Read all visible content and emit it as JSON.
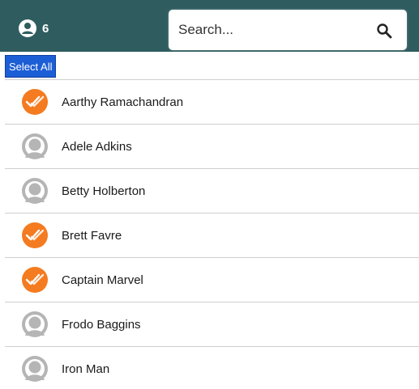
{
  "header": {
    "user_count": "6",
    "background_color": "#2f5d5f",
    "count_icon": "user-circle-icon"
  },
  "search": {
    "placeholder": "Search...",
    "value": "",
    "icon": "search-icon"
  },
  "select_all": {
    "label": "Select All",
    "color": "#1c5ed6"
  },
  "users": [
    {
      "name": "Aarthy Ramachandran",
      "selected": true
    },
    {
      "name": "Adele Adkins",
      "selected": false
    },
    {
      "name": "Betty Holberton",
      "selected": false
    },
    {
      "name": "Brett Favre",
      "selected": true
    },
    {
      "name": "Captain Marvel",
      "selected": true
    },
    {
      "name": "Frodo Baggins",
      "selected": false
    },
    {
      "name": "Iron Man",
      "selected": false
    }
  ],
  "colors": {
    "selected_accent": "#f47b20",
    "unselected_avatar": "#b5b5b5"
  }
}
